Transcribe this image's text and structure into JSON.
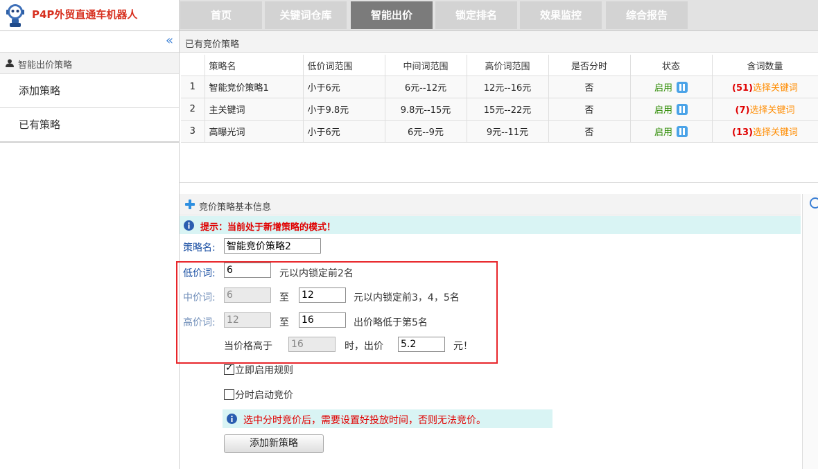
{
  "app": {
    "title": "P4P外贸直通车机器人"
  },
  "nav": {
    "tabs": [
      "首页",
      "关键词仓库",
      "智能出价",
      "锁定排名",
      "效果监控",
      "综合报告"
    ],
    "active_index": 2
  },
  "sidebar": {
    "section_title": "智能出价策略",
    "items": [
      {
        "label": "添加策略"
      },
      {
        "label": "已有策略"
      }
    ]
  },
  "strategy_panel": {
    "title": "已有竞价策略",
    "columns": [
      "",
      "策略名",
      "低价词范围",
      "中间词范围",
      "高价词范围",
      "是否分时",
      "状态",
      "含词数量"
    ],
    "rows": [
      {
        "index": "1",
        "name": "智能竞价策略1",
        "low": "小于6元",
        "mid": "6元--12元",
        "high": "12元--16元",
        "timed": "否",
        "status": "启用",
        "count": "(51)",
        "link": "选择关键词"
      },
      {
        "index": "2",
        "name": "主关键词",
        "low": "小于9.8元",
        "mid": "9.8元--15元",
        "high": "15元--22元",
        "timed": "否",
        "status": "启用",
        "count": "(7)",
        "link": "选择关键词"
      },
      {
        "index": "3",
        "name": "高曝光词",
        "low": "小于6元",
        "mid": "6元--9元",
        "high": "9元--11元",
        "timed": "否",
        "status": "启用",
        "count": "(13)",
        "link": "选择关键词"
      }
    ]
  },
  "basic_info": {
    "title": "竞价策略基本信息",
    "notice": "提示：当前处于新增策略的模式！",
    "name_label": "策略名:",
    "name_value": "智能竞价策略2",
    "low_label": "低价词:",
    "low_value": "6",
    "low_suffix": "元以内锁定前2名",
    "mid_label": "中价词:",
    "mid_from": "6",
    "to_text": "至",
    "mid_to": "12",
    "mid_suffix": "元以内锁定前3，4，5名",
    "high_label": "高价词:",
    "high_from": "12",
    "high_to": "16",
    "high_suffix": "出价略低于第5名",
    "over_prefix": "当价格高于",
    "over_value": "16",
    "over_mid": "时，出价",
    "over_bid": "5.2",
    "over_suffix": "元！",
    "enable_rule_label": "立即启用规则",
    "enable_rule_checked": true,
    "timed_label": "分时启动竞价",
    "timed_checked": false,
    "warning": "选中分时竞价后，需要设置好投放时间，否则无法竞价。",
    "add_button": "添加新策略"
  },
  "colors": {
    "brand": "#d7301f",
    "active_tab": "#7b7b7b",
    "tab": "#d3d3d3",
    "notice_bg": "#d9f4f4",
    "alert": "#e00000",
    "link": "#ff8c00",
    "enabled": "#2b8a00",
    "highlight_box": "#e8262b"
  },
  "icons": {
    "logo": "robot-logo-icon",
    "collapse": "double-chevron-left-icon",
    "user": "user-icon",
    "pause": "pause-icon",
    "plus": "plus-icon",
    "info": "info-icon",
    "scroll": "circle-icon"
  }
}
